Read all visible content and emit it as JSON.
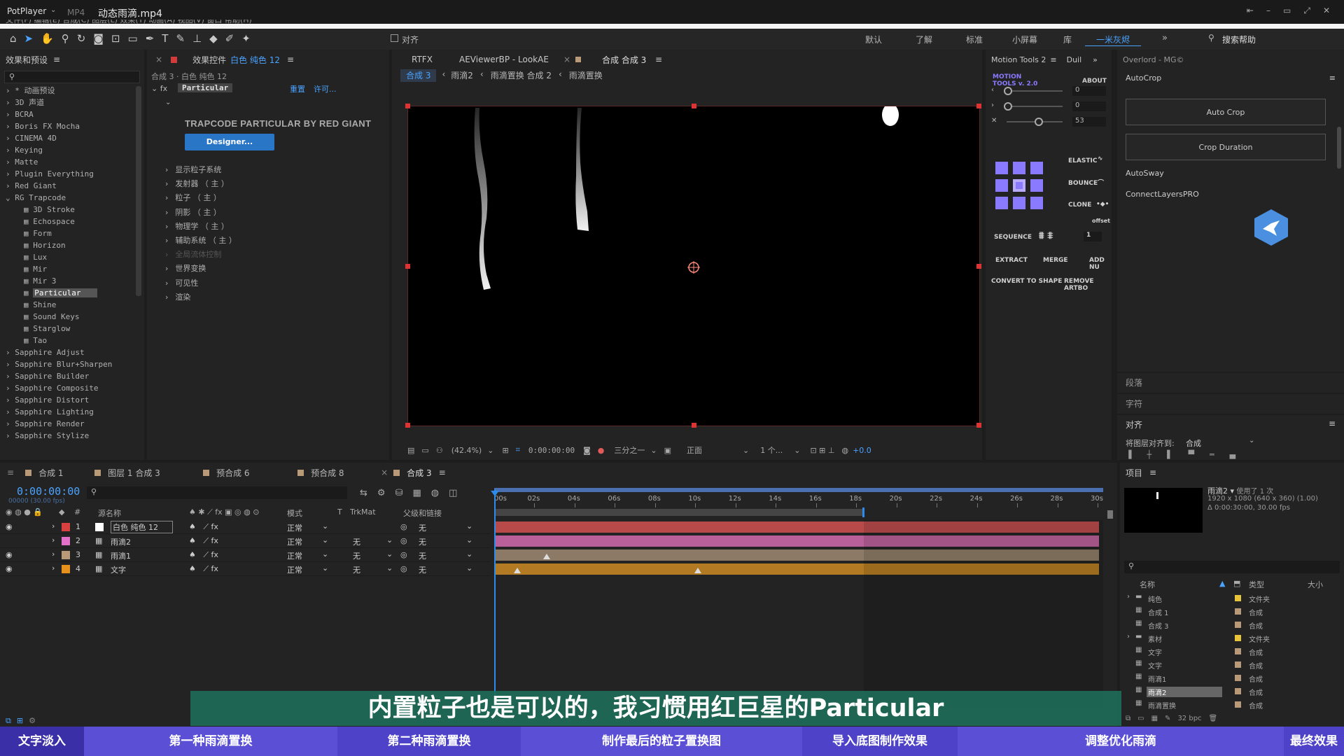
{
  "titlebar": {
    "app": "PotPlayer",
    "format": "MP4",
    "file": "动态雨滴.mp4",
    "menu_partial": "文件(F)  编辑(E)  合成(C)  图层(L)  效果(T)  动画(A)  视图(V)  窗口  帮助(H)"
  },
  "toolbar": {
    "snap": "对齐",
    "workspaces": [
      "默认",
      "了解",
      "标准",
      "小屏幕",
      "库",
      "一米灰烬"
    ],
    "search": "搜索帮助"
  },
  "effects": {
    "title": "效果和预设",
    "items": [
      {
        "label": "* 动画预设",
        "depth": 0
      },
      {
        "label": "3D 声道",
        "depth": 0
      },
      {
        "label": "BCRA",
        "depth": 0
      },
      {
        "label": "Boris FX Mocha",
        "depth": 0
      },
      {
        "label": "CINEMA 4D",
        "depth": 0
      },
      {
        "label": "Keying",
        "depth": 0
      },
      {
        "label": "Matte",
        "depth": 0
      },
      {
        "label": "Plugin Everything",
        "depth": 0
      },
      {
        "label": "Red Giant",
        "depth": 0
      },
      {
        "label": "RG Trapcode",
        "depth": 0,
        "open": true
      },
      {
        "label": "3D Stroke",
        "depth": 1
      },
      {
        "label": "Echospace",
        "depth": 1
      },
      {
        "label": "Form",
        "depth": 1
      },
      {
        "label": "Horizon",
        "depth": 1
      },
      {
        "label": "Lux",
        "depth": 1
      },
      {
        "label": "Mir",
        "depth": 1
      },
      {
        "label": "Mir 3",
        "depth": 1
      },
      {
        "label": "Particular",
        "depth": 1,
        "selected": true
      },
      {
        "label": "Shine",
        "depth": 1
      },
      {
        "label": "Sound Keys",
        "depth": 1
      },
      {
        "label": "Starglow",
        "depth": 1
      },
      {
        "label": "Tao",
        "depth": 1
      },
      {
        "label": "Sapphire Adjust",
        "depth": 0
      },
      {
        "label": "Sapphire Blur+Sharpen",
        "depth": 0
      },
      {
        "label": "Sapphire Builder",
        "depth": 0
      },
      {
        "label": "Sapphire Composite",
        "depth": 0
      },
      {
        "label": "Sapphire Distort",
        "depth": 0
      },
      {
        "label": "Sapphire Lighting",
        "depth": 0
      },
      {
        "label": "Sapphire Render",
        "depth": 0
      },
      {
        "label": "Sapphire Stylize",
        "depth": 0
      }
    ]
  },
  "effect_controls": {
    "tab_prefix": "效果控件",
    "tab_layer": "白色 纯色 12",
    "breadcrumb": "合成 3 · 白色 纯色 12",
    "effect_name": "Particular",
    "reset": "重置",
    "license": "许可...",
    "banner": "TRAPCODE PARTICULAR BY RED GIANT",
    "designer": "Designer...",
    "props": [
      "显示粒子系统",
      "发射器 （ 主 ）",
      "粒子 （ 主 ）",
      "阴影 （ 主 ）",
      "物理学 （ 主 ）",
      "辅助系统 （ 主 ）",
      "全局流体控制",
      "世界变换",
      "可见性",
      "渲染"
    ]
  },
  "viewer": {
    "tabs": [
      "RTFX",
      "AEViewerBP - LookAE",
      "合成 合成 3"
    ],
    "crumbs": [
      "合成 3",
      "雨滴2",
      "雨滴置换 合成 2",
      "雨滴置换"
    ],
    "zoom": "(42.4%)",
    "time": "0:00:00:00",
    "resolution": "三分之一",
    "view": "正面",
    "views": "1 个...",
    "exposure": "+0.0"
  },
  "motion_tools": {
    "tab": "Motion Tools 2",
    "tab2": "Duil",
    "logo": "MOTION TOOLS v. 2.0",
    "about": "ABOUT",
    "val1": "0",
    "val2": "0",
    "val3": "53",
    "elastic": "ELASTIC",
    "bounce": "BOUNCE",
    "clone": "CLONE",
    "offset": "offset",
    "sequence": "SEQUENCE",
    "seq_val": "1",
    "extract": "EXTRACT",
    "merge": "MERGE",
    "add": "ADD NU",
    "convert": "CONVERT TO SHAPE",
    "remove": "REMOVE ARTBO"
  },
  "overlord": {
    "tab": "Overlord - MG©",
    "autocrop": "AutoCrop",
    "btn_autocrop": "Auto Crop",
    "btn_duration": "Crop Duration",
    "autosway": "AutoSway",
    "connect": "ConnectLayersPRO",
    "para": "段落",
    "char": "字符",
    "align": "对齐",
    "align_to_label": "将图层对齐到:",
    "align_to_value": "合成"
  },
  "timeline": {
    "tabs": [
      "合成 1",
      "图层 1 合成 3",
      "预合成 6",
      "预合成 8",
      "合成 3"
    ],
    "timecode": "0:00:00:00",
    "frames": "00000 (30.00 fps)",
    "headers": {
      "name": "源名称",
      "mode": "模式",
      "t": "T",
      "trkmat": "TrkMat",
      "parent": "父级和链接"
    },
    "ruler": [
      "00s",
      "02s",
      "04s",
      "06s",
      "08s",
      "10s",
      "12s",
      "14s",
      "16s",
      "18s",
      "20s",
      "22s",
      "24s",
      "26s",
      "28s",
      "30s"
    ],
    "layers": [
      {
        "num": "1",
        "name": "白色 纯色 12",
        "mode": "正常",
        "trk": "",
        "parent": "无",
        "color": "#d94040",
        "bar": "#b94a4a"
      },
      {
        "num": "2",
        "name": "雨滴2",
        "mode": "正常",
        "trk": "无",
        "parent": "无",
        "color": "#e070c8",
        "bar": "#b9609a"
      },
      {
        "num": "3",
        "name": "雨滴1",
        "mode": "正常",
        "trk": "无",
        "parent": "无",
        "color": "#b89a78",
        "bar": "#8c7a66"
      },
      {
        "num": "4",
        "name": "文字",
        "mode": "正常",
        "trk": "无",
        "parent": "无",
        "color": "#e8901c",
        "bar": "#b27a22"
      }
    ]
  },
  "project": {
    "title": "项目",
    "thumb_name": "雨滴2",
    "thumb_used": "使用了 1 次",
    "thumb_info1": "1920 x 1080  (640 x 360) (1.00)",
    "thumb_info2": "Δ 0:00:30:00, 30.00 fps",
    "col_name": "名称",
    "col_type": "类型",
    "col_size": "大小",
    "items": [
      {
        "name": "纯色",
        "type": "文件夹",
        "color": "#e8c43a",
        "folder": true
      },
      {
        "name": "合成 1",
        "type": "合成",
        "color": "#b89a78"
      },
      {
        "name": "合成 3",
        "type": "合成",
        "color": "#b89a78"
      },
      {
        "name": "素材",
        "type": "文件夹",
        "color": "#e8c43a",
        "folder": true
      },
      {
        "name": "文字",
        "type": "合成",
        "color": "#b89a78"
      },
      {
        "name": "文字",
        "type": "合成",
        "color": "#b89a78"
      },
      {
        "name": "雨滴1",
        "type": "合成",
        "color": "#b89a78"
      },
      {
        "name": "雨滴2",
        "type": "合成",
        "color": "#b89a78",
        "selected": true
      },
      {
        "name": "雨滴置换",
        "type": "合成",
        "color": "#b89a78"
      }
    ],
    "bpc": "32 bpc"
  },
  "subtitle": "内置粒子也是可以的，我习惯用红巨星的Particular",
  "chapters": [
    "文字淡入",
    "第一种雨滴置换",
    "第二种雨滴置换",
    "制作最后的粒子置换图",
    "导入底图制作效果",
    "调整优化雨滴",
    "最终效果"
  ],
  "colors": {
    "accent": "#2d8ceb",
    "chapter_bar": "#5b4fd6",
    "chapter_active": "#3b2fa8"
  }
}
